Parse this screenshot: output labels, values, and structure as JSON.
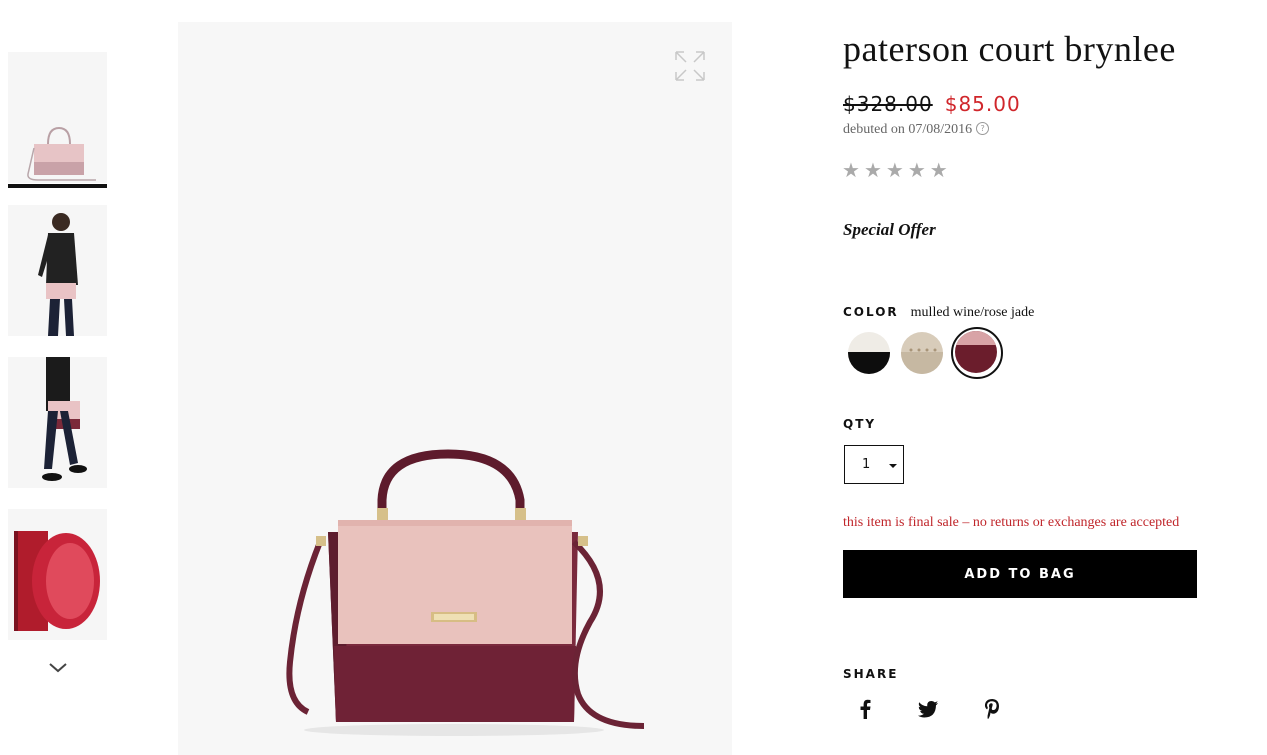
{
  "product": {
    "title": "paterson court brynlee",
    "price_original": "$328.00",
    "price_sale": "$85.00",
    "debut": "debuted on 07/08/2016",
    "rating_stars": 0,
    "rating_max": 5,
    "promo": "Special Offer"
  },
  "color": {
    "label": "COLOR",
    "selected": "mulled wine/rose jade",
    "swatches": [
      {
        "name": "cream/black",
        "top": "#efece6",
        "bottom": "#0d0d0d"
      },
      {
        "name": "beige",
        "top": "#d8ccba",
        "bottom": "#c3b5a0"
      },
      {
        "name": "mulled wine/rose jade",
        "top": "#d8a3a6",
        "bottom": "#6b1d2c"
      }
    ]
  },
  "qty": {
    "label": "QTY",
    "value": "1"
  },
  "notice": "this item is final sale – no returns or exchanges are accepted",
  "add_to_bag": "ADD TO BAG",
  "share": {
    "label": "SHARE",
    "networks": [
      "facebook",
      "twitter",
      "pinterest"
    ]
  },
  "icons": {
    "zoom": "expand-icon",
    "next": "chevron-down-icon",
    "info": "info-icon",
    "star": "star-icon"
  }
}
